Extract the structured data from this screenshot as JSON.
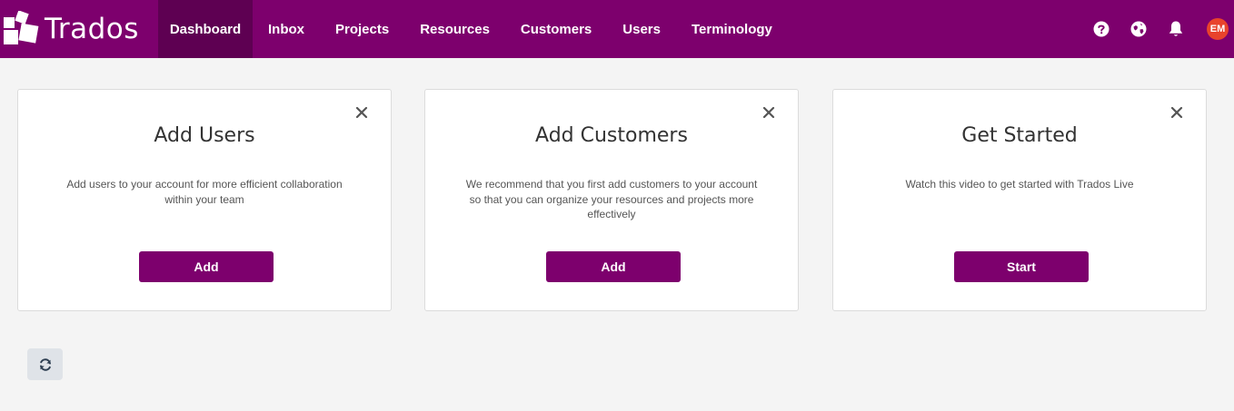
{
  "app": {
    "name": "Trados"
  },
  "nav": {
    "items": [
      {
        "label": "Dashboard",
        "active": true
      },
      {
        "label": "Inbox"
      },
      {
        "label": "Projects"
      },
      {
        "label": "Resources"
      },
      {
        "label": "Customers"
      },
      {
        "label": "Users"
      },
      {
        "label": "Terminology"
      }
    ],
    "icons": [
      "help-icon",
      "globe-icon",
      "bell-icon"
    ],
    "avatar_initials": "EM"
  },
  "cards": [
    {
      "title": "Add Users",
      "description": "Add users to your account for more efficient collaboration within your team",
      "button": "Add"
    },
    {
      "title": "Add Customers",
      "description": "We recommend that you first add customers to your account so that you can organize your resources and projects more effectively",
      "button": "Add"
    },
    {
      "title": "Get Started",
      "description": "Watch this video to get started with Trados Live",
      "button": "Start"
    }
  ],
  "colors": {
    "brand": "#7d006d",
    "nav_active": "#5e0052",
    "avatar": "#e8432c",
    "background": "#f4f4f4"
  }
}
